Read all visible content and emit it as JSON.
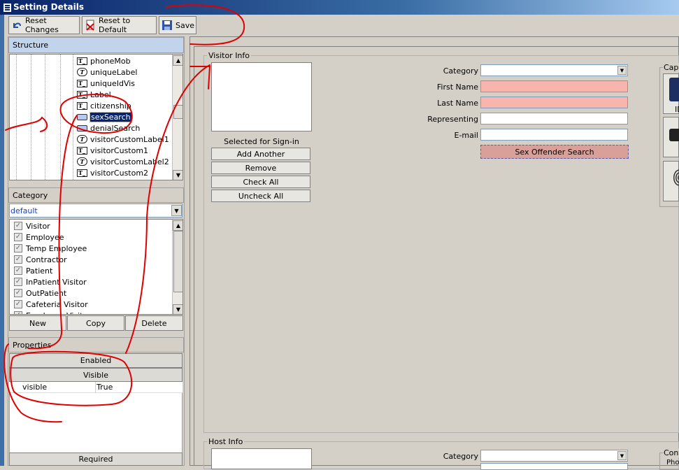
{
  "window": {
    "title": "Setting Details"
  },
  "toolbar": {
    "reset_changes": "Reset Changes",
    "reset_default": "Reset to Default",
    "save": "Save"
  },
  "structure": {
    "header": "Structure",
    "items": [
      {
        "label": "phoneMob",
        "icon": "textbox"
      },
      {
        "label": "uniqueLabel",
        "icon": "label"
      },
      {
        "label": "uniqueIdVis",
        "icon": "textbox"
      },
      {
        "label": "Label",
        "icon": "textbox"
      },
      {
        "label": "citizenship",
        "icon": "textbox"
      },
      {
        "label": "sexSearch",
        "icon": "button",
        "selected": true
      },
      {
        "label": "denialSearch",
        "icon": "button"
      },
      {
        "label": "visitorCustomLabel1",
        "icon": "label"
      },
      {
        "label": "visitorCustom1",
        "icon": "textbox"
      },
      {
        "label": "visitorCustomLabel2",
        "icon": "label"
      },
      {
        "label": "visitorCustom2",
        "icon": "textbox"
      }
    ]
  },
  "category": {
    "header": "Category",
    "selected": "default",
    "items": [
      "Visitor",
      "Employee",
      "Temp Employee",
      "Contractor",
      "Patient",
      "InPatient Visitor",
      "OutPatient",
      "Cafeteria Visitor",
      "Employee Visitor"
    ],
    "new": "New",
    "copy": "Copy",
    "delete": "Delete"
  },
  "properties": {
    "header": "Properties",
    "groups": [
      "Enabled",
      "Visible"
    ],
    "row": {
      "name": "visible",
      "value": "True"
    },
    "required": "Required"
  },
  "visitor": {
    "legend": "Visitor Info",
    "selected_label": "Selected for Sign-in",
    "buttons": [
      "Add Another",
      "Remove",
      "Check All",
      "Uncheck All"
    ],
    "fields": [
      "Category",
      "First Name",
      "Last Name",
      "Representing",
      "E-mail"
    ],
    "sex_offender": "Sex Offender Search",
    "capture_legend": "Capt",
    "capture_id": "ID"
  },
  "host": {
    "legend": "Host Info",
    "category": "Category",
    "contact_legend": "Cont",
    "phone": "Pho"
  },
  "colors": {
    "required_field": "#f7b5ae",
    "sex_offender_button": "#d9a09a",
    "annotation": "#e00000"
  }
}
